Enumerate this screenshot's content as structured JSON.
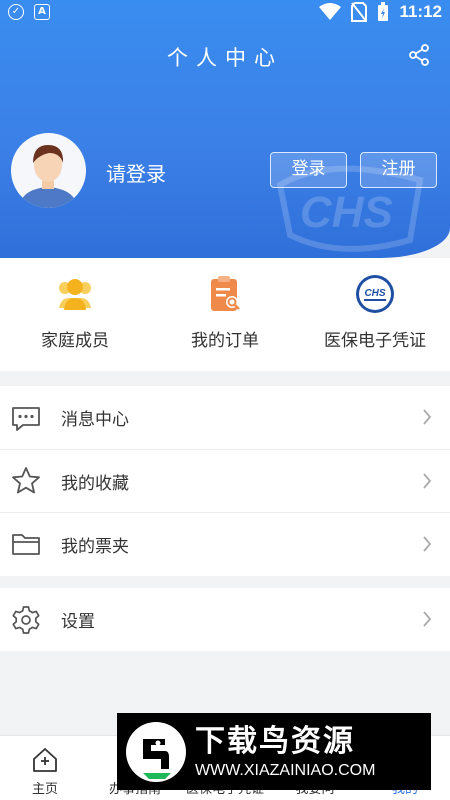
{
  "status_bar": {
    "time": "11:12"
  },
  "header": {
    "title": "个人中心",
    "login_prompt": "请登录",
    "login_button": "登录",
    "register_button": "注册"
  },
  "quick_items": [
    {
      "label": "家庭成员",
      "icon": "family-icon"
    },
    {
      "label": "我的订单",
      "icon": "order-icon"
    },
    {
      "label": "医保电子凭证",
      "icon": "chs-icon"
    }
  ],
  "menu": [
    {
      "label": "消息中心",
      "icon": "message-icon"
    },
    {
      "label": "我的收藏",
      "icon": "star-icon"
    },
    {
      "label": "我的票夹",
      "icon": "folder-icon"
    },
    {
      "label": "设置",
      "icon": "gear-icon"
    }
  ],
  "tabs": [
    {
      "label": "主页",
      "icon": "home-icon"
    },
    {
      "label": "办事指南"
    },
    {
      "label": "医保电子凭证"
    },
    {
      "label": "我要问"
    },
    {
      "label": "我的"
    }
  ],
  "watermark": {
    "title": "下载鸟资源",
    "url": "WWW.XIAZAINIAO.COM"
  },
  "colors": {
    "primary": "#3b83eb",
    "active_tab": "#2f73e6",
    "order_icon": "#f08a4b",
    "family_icon": "#f5b21f"
  }
}
